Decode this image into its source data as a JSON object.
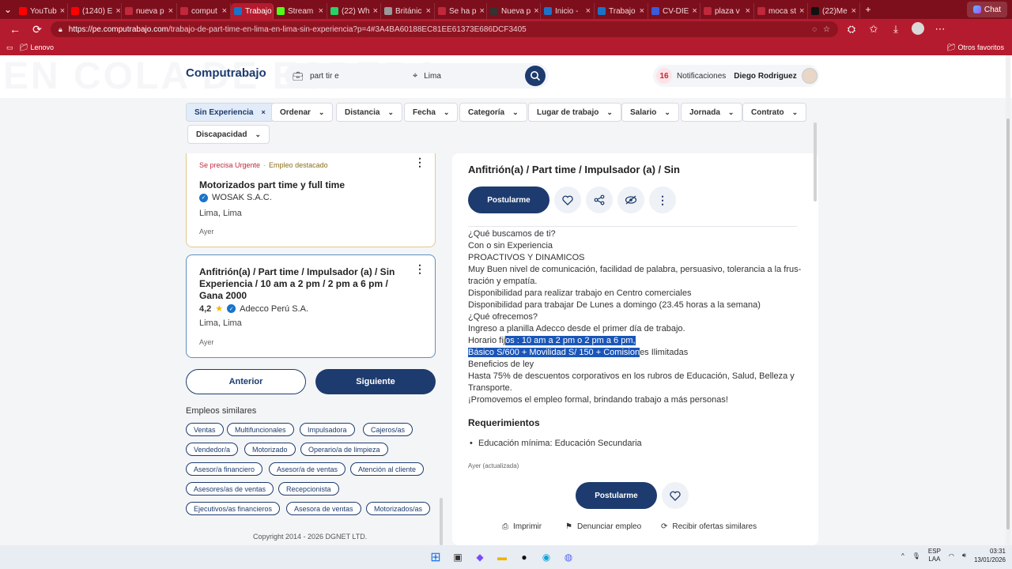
{
  "browser": {
    "tabs": [
      {
        "label": "YouTub",
        "color": "#ff0000"
      },
      {
        "label": "(1240) E",
        "color": "#ff0000"
      },
      {
        "label": "nueva p",
        "color": "#c0283b"
      },
      {
        "label": "comput",
        "color": "#c0283b"
      },
      {
        "label": "Trabajo",
        "color": "#1a73c9",
        "active": true
      },
      {
        "label": "Stream",
        "color": "#53fc18"
      },
      {
        "label": "(22) Wh",
        "color": "#25d366"
      },
      {
        "label": "Británic",
        "color": "#999999"
      },
      {
        "label": "Se ha p",
        "color": "#c0283b"
      },
      {
        "label": "Nueva p",
        "color": "#333333"
      },
      {
        "label": "Inicio -",
        "color": "#1a73c9"
      },
      {
        "label": "Trabajo",
        "color": "#1a73c9"
      },
      {
        "label": "CV-DIE",
        "color": "#3b5bdb"
      },
      {
        "label": "plaza v",
        "color": "#c0283b"
      },
      {
        "label": "moca st",
        "color": "#c0283b"
      },
      {
        "label": "(22)Me",
        "color": "#111111"
      }
    ],
    "chat_label": "Chat",
    "url_host": "https://pe.computrabajo.com",
    "url_path": "/trabajo-de-part-time-en-lima-en-lima-sin-experiencia?p=4#3A4BA60188EC81EE61373E686DCF3405",
    "fav_lenovo": "Lenovo",
    "fav_others": "Otros favoritos"
  },
  "header": {
    "logo": "Computrabajo",
    "watermark": "EN COLA DE ESPERA",
    "search_value": "part tir e",
    "location_value": "Lima",
    "notif_count": "16",
    "notif_label": "Notificaciones",
    "username": "Diego Rodriguez"
  },
  "filters": [
    {
      "label": "Sin Experiencia",
      "active": true
    },
    {
      "label": "Ordenar"
    },
    {
      "label": "Distancia"
    },
    {
      "label": "Fecha"
    },
    {
      "label": "Categoría"
    },
    {
      "label": "Lugar de trabajo"
    },
    {
      "label": "Salario"
    },
    {
      "label": "Jornada"
    },
    {
      "label": "Contrato"
    },
    {
      "label": "Discapacidad"
    }
  ],
  "jobs": [
    {
      "tag_urgent": "Se precisa Urgente",
      "tag_featured": "Empleo destacado",
      "title": "Motorizados part time y full time",
      "company": "WOSAK S.A.C.",
      "location": "Lima, Lima",
      "date": "Ayer"
    },
    {
      "title": "Anfitrión(a) / Part time / Impulsador (a) / Sin Experiencia / 10 am a 2 pm / 2 pm a 6 pm / Gana 2000",
      "rating": "4,2",
      "company": "Adecco Perú S.A.",
      "location": "Lima, Lima",
      "date": "Ayer"
    }
  ],
  "pagination": {
    "prev": "Anterior",
    "next": "Siguiente"
  },
  "similar": {
    "title": "Empleos similares",
    "chips": [
      "Ventas",
      "Multifuncionales",
      "Impulsadora",
      "Cajeros/as",
      "Vendedor/a",
      "Motorizado",
      "Operario/a de limpieza",
      "Asesor/a financiero",
      "Asesor/a de ventas",
      "Atención al cliente",
      "Asesores/as de ventas",
      "Recepcionista",
      "Ejecutivos/as financieros",
      "Asesora de ventas",
      "Motorizados/as"
    ]
  },
  "copyright": "Copyright 2014 - 2026 DGNET LTD.",
  "detail": {
    "title": "Anfitrión(a) / Part time / Impulsador (a) / Sin",
    "apply_label": "Postularme",
    "lines": [
      "¿Qué buscamos de ti?",
      "Con o sin Experiencia",
      "PROACTIVOS Y DINAMICOS",
      "Muy Buen nivel de comunicación, facilidad de palabra, persuasivo, tolerancia a la frus-",
      "tración y empatía.",
      "Disponibilidad para realizar trabajo en Centro comerciales",
      "Disponibilidad para trabajar De Lunes a domingo (23.45 horas a la semana)",
      "¿Qué ofrecemos?",
      "Ingreso a planilla Adecco desde el primer día de trabajo."
    ],
    "horario_pre": "Horario fij",
    "horario_hl": "os : 10 am a 2 pm o 2 pm a 6 pm,",
    "basico_hl": "Básico S/600 + Movilidad S/ 150 + Comision",
    "basico_post": "es Ilimitadas",
    "lines_after": [
      "Beneficios de ley",
      "Hasta 75% de descuentos corporativos en los rubros de Educación, Salud, Belleza y",
      "Transporte.",
      "¡Promovemos el empleo formal, brindando trabajo a más personas!"
    ],
    "req_title": "Requerimientos",
    "req_item": "Educación mínima: Educación Secundaria",
    "updated": "Ayer (actualizada)",
    "print": "Imprimir",
    "report": "Denunciar empleo",
    "similar_offers": "Recibir ofertas similares"
  },
  "taskbar": {
    "lang1": "ESP",
    "lang2": "LAA",
    "time": "03:31",
    "date": "13/01/2026"
  }
}
